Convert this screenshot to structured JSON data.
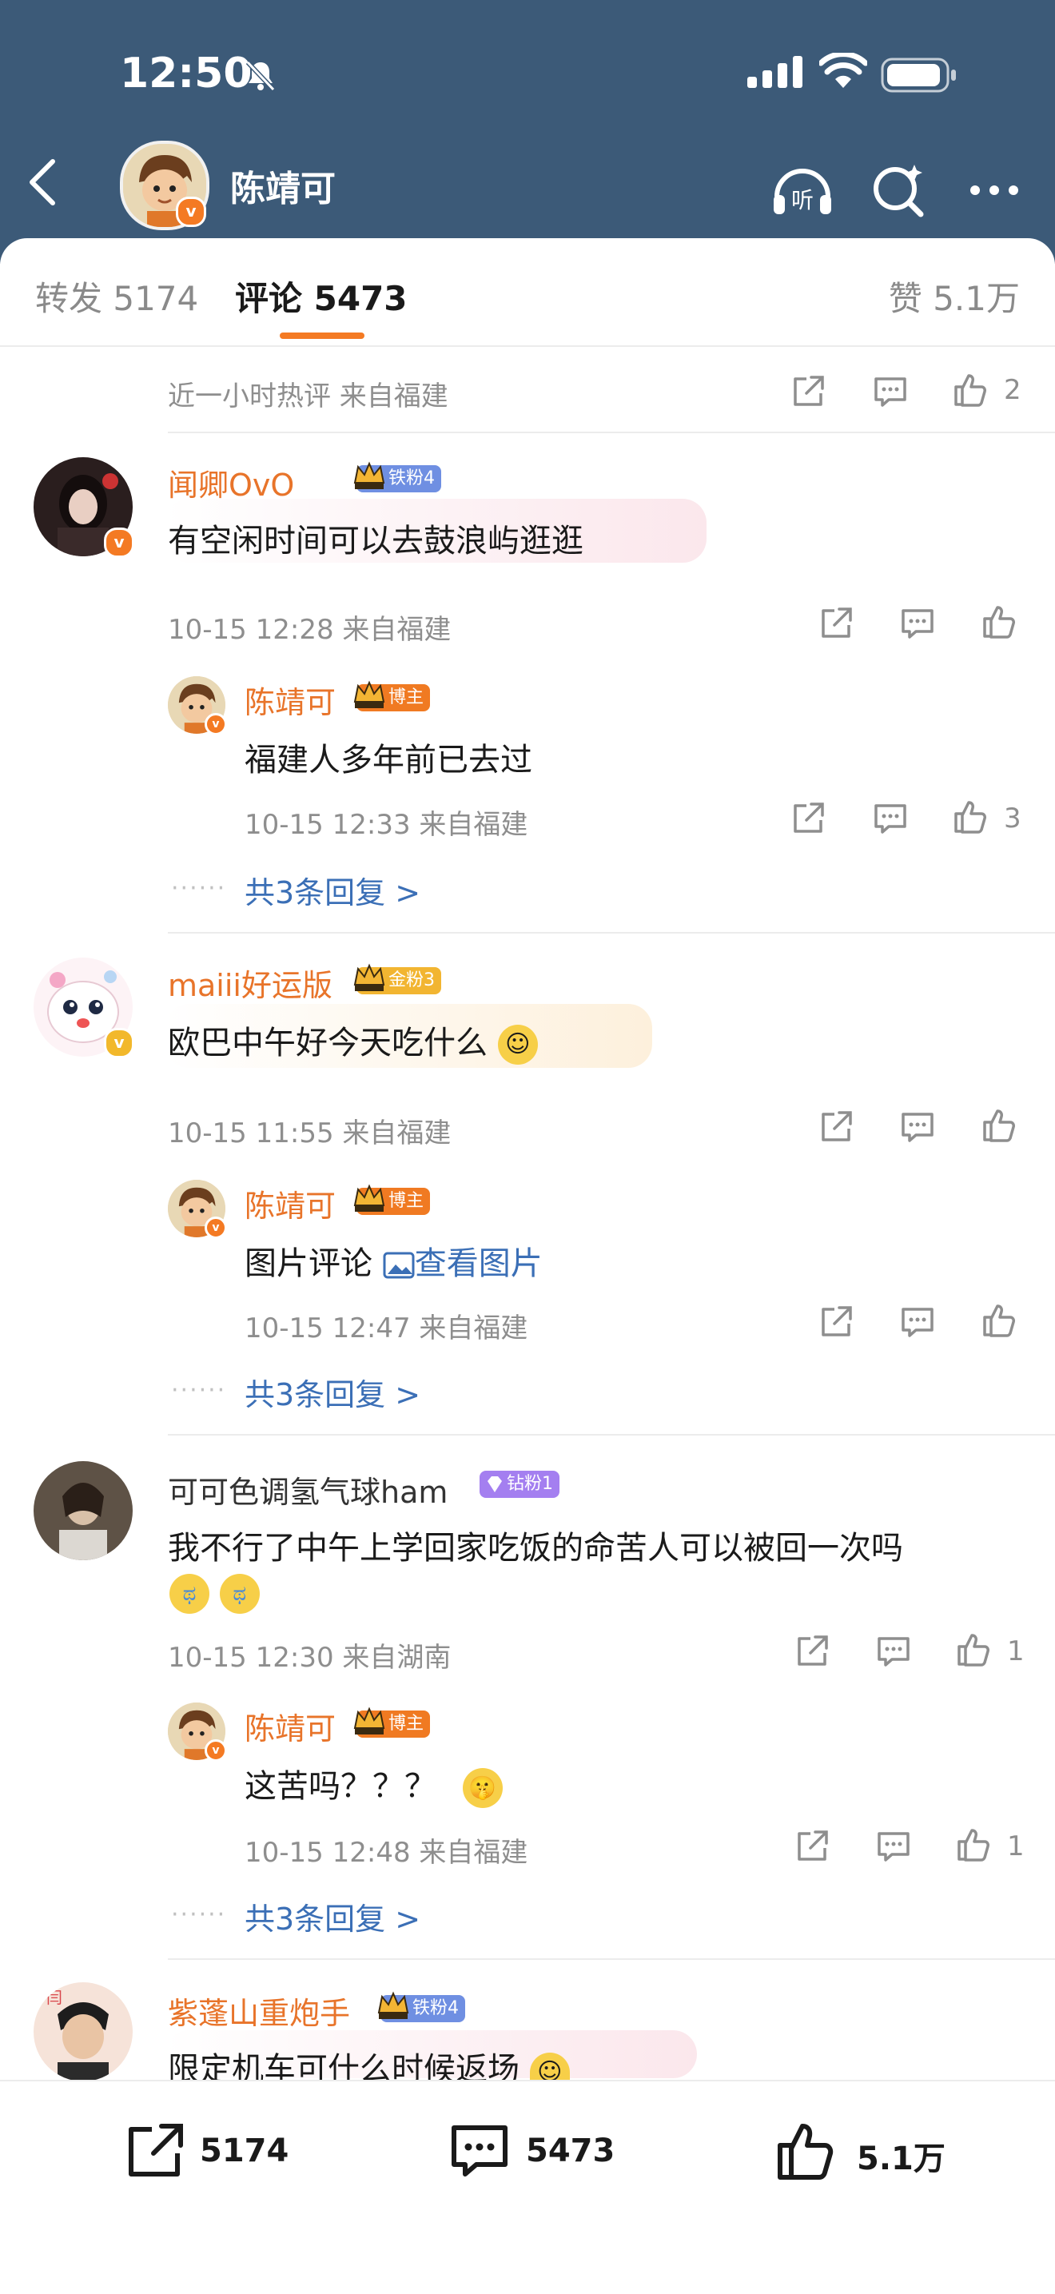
{
  "status_bar": {
    "time": "12:50"
  },
  "header": {
    "name": "陈靖可"
  },
  "tabs": {
    "repost": "转发 5174",
    "comment": "评论 5473",
    "like": "赞 5.1万"
  },
  "partial_top": {
    "meta": "近一小时热评  来自福建",
    "likes": "2"
  },
  "comments": [
    {
      "username": "闻卿OvO",
      "badge": "铁粉4",
      "text": "有空闲时间可以去鼓浪屿逛逛",
      "meta": "10-15 12:28  来自福建",
      "likes": "",
      "reply": {
        "username": "陈靖可",
        "badge": "博主",
        "text": "福建人多年前已去过",
        "meta": "10-15 12:33  来自福建",
        "likes": "3"
      },
      "more": "共3条回复 >"
    },
    {
      "username": "maiii好运版",
      "badge": "金粉3",
      "text": "欧巴中午好今天吃什么",
      "meta": "10-15 11:55  来自福建",
      "likes": "",
      "reply": {
        "username": "陈靖可",
        "badge": "博主",
        "text": "图片评论",
        "link": "查看图片",
        "meta": "10-15 12:47  来自福建",
        "likes": ""
      },
      "more": "共3条回复 >"
    },
    {
      "username": "可可色调氢气球ham",
      "badge": "钻粉1",
      "text": "我不行了中午上学回家吃饭的命苦人可以被回一次吗",
      "meta": "10-15 12:30  来自湖南",
      "likes": "1",
      "reply": {
        "username": "陈靖可",
        "badge": "博主",
        "text": "这苦吗？？？",
        "meta": "10-15 12:48  来自福建",
        "likes": "1"
      },
      "more": "共3条回复 >"
    },
    {
      "username": "紫蓬山重炮手",
      "badge": "铁粉4",
      "text": "限定机车可什么时候返场"
    }
  ],
  "bottom_bar": {
    "repost": "5174",
    "comment": "5473",
    "like": "5.1万"
  },
  "colors": {
    "header_bg": "#3c5a78",
    "accent": "#f47a23",
    "link": "#3b6fb6",
    "username": "#e8742a"
  }
}
